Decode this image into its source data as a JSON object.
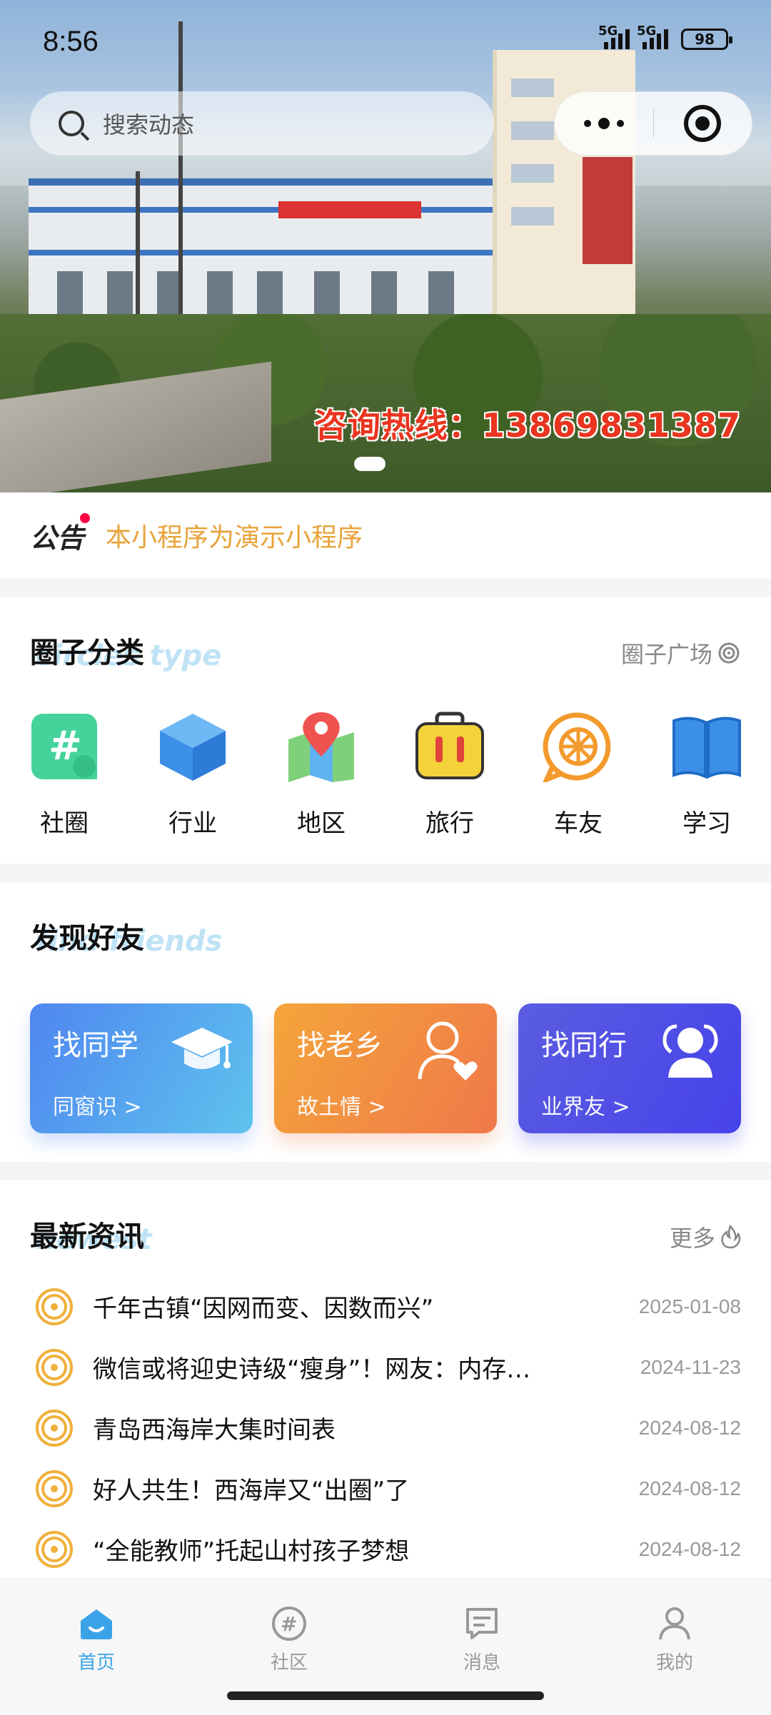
{
  "status": {
    "time": "8:56",
    "sig1": "5G",
    "sig2": "5G",
    "battery": "98"
  },
  "search": {
    "placeholder": "搜索动态"
  },
  "banner": {
    "hotline": "咨询热线：13869831387"
  },
  "notice": {
    "icon_text": "公告",
    "text": "本小程序为演示小程序"
  },
  "categories": {
    "title": "圈子分类",
    "subtitle": "circles type",
    "link": "圈子广场",
    "items": [
      {
        "label": "社圈",
        "icon": "hashtag-icon"
      },
      {
        "label": "行业",
        "icon": "cube-icon"
      },
      {
        "label": "地区",
        "icon": "map-pin-icon"
      },
      {
        "label": "旅行",
        "icon": "suitcase-icon"
      },
      {
        "label": "车友",
        "icon": "wheel-icon"
      },
      {
        "label": "学习",
        "icon": "book-icon"
      }
    ]
  },
  "friends": {
    "title": "发现好友",
    "subtitle": "find friends",
    "cards": [
      {
        "title": "找同学",
        "sub": "同窗识 >",
        "icon": "graduation-cap-icon",
        "color_from": "#4f8af0",
        "color_to": "#5ec2f0"
      },
      {
        "title": "找老乡",
        "sub": "故土情 >",
        "icon": "person-heart-icon",
        "color_from": "#f4a23c",
        "color_to": "#f07a45"
      },
      {
        "title": "找同行",
        "sub": "业界友 >",
        "icon": "people-icon",
        "color_from": "#5656e0",
        "color_to": "#4940ea"
      }
    ]
  },
  "news": {
    "title": "最新资讯",
    "subtitle": "newest",
    "link": "更多",
    "items": [
      {
        "title": "千年古镇“因网而变、因数而兴”",
        "date": "2025-01-08"
      },
      {
        "title": "微信或将迎史诗级“瘦身”！网友：内存…",
        "date": "2024-11-23"
      },
      {
        "title": "青岛西海岸大集时间表",
        "date": "2024-08-12"
      },
      {
        "title": "好人共生！西海岸又“出圈”了",
        "date": "2024-08-12"
      },
      {
        "title": "“全能教师”托起山村孩子梦想",
        "date": "2024-08-12"
      }
    ]
  },
  "tabbar": {
    "tabs": [
      {
        "label": "首页",
        "icon": "home-icon",
        "active": true
      },
      {
        "label": "社区",
        "icon": "community-icon",
        "active": false
      },
      {
        "label": "消息",
        "icon": "message-icon",
        "active": false
      },
      {
        "label": "我的",
        "icon": "profile-icon",
        "active": false
      }
    ]
  },
  "colors": {
    "accent": "#3aa3e8",
    "notice": "#e8a33a",
    "news_icon": "#f0b03c"
  }
}
